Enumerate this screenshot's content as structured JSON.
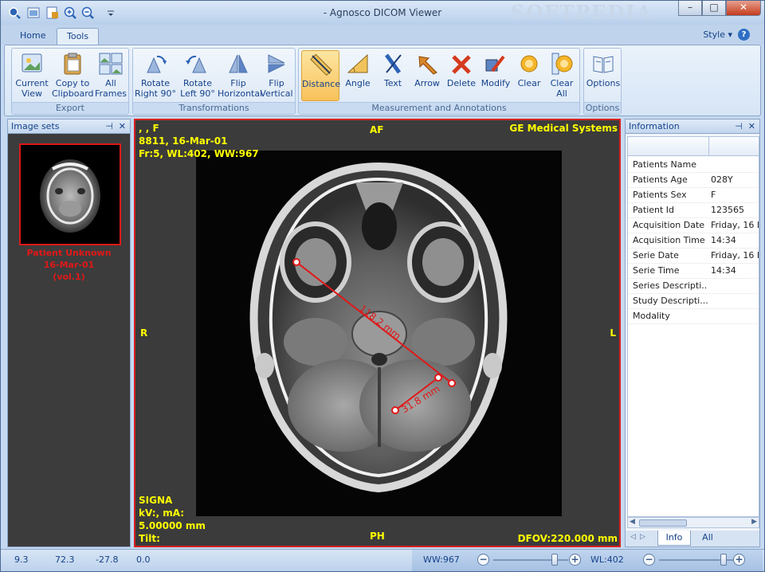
{
  "app": {
    "title": "- Agnosco DICOM Viewer",
    "watermark": "SOFTPEDIA"
  },
  "colors": {
    "annotation": "#e01818",
    "overlay_text": "#ffff00",
    "active_button": "#f9c15a"
  },
  "quick_access": [
    "open-icon",
    "save-icon",
    "export-icon",
    "zoom-in-icon",
    "zoom-out-icon",
    "customize-icon"
  ],
  "window_controls": {
    "minimize": "–",
    "maximize": "□",
    "close": "✕"
  },
  "tabs": [
    {
      "label": "Home"
    },
    {
      "label": "Tools",
      "active": true
    }
  ],
  "style_menu": {
    "label": "Style",
    "help": "?"
  },
  "ribbon": {
    "export": {
      "label": "Export",
      "buttons": [
        {
          "line1": "Current",
          "line2": "View"
        },
        {
          "line1": "Copy to",
          "line2": "Clipboard"
        },
        {
          "line1": "All",
          "line2": "Frames"
        }
      ]
    },
    "transformations": {
      "label": "Transformations",
      "buttons": [
        {
          "line1": "Rotate",
          "line2": "Right 90°"
        },
        {
          "line1": "Rotate",
          "line2": "Left 90°"
        },
        {
          "line1": "Flip",
          "line2": "Horizontal"
        },
        {
          "line1": "Flip",
          "line2": "Vertical"
        }
      ]
    },
    "measurement": {
      "label": "Measurement and Annotations",
      "buttons": [
        {
          "line1": "Distance",
          "line2": "",
          "active": true
        },
        {
          "line1": "Angle",
          "line2": ""
        },
        {
          "line1": "Text",
          "line2": ""
        },
        {
          "line1": "Arrow",
          "line2": ""
        },
        {
          "line1": "Delete",
          "line2": ""
        },
        {
          "line1": "Modify",
          "line2": ""
        },
        {
          "line1": "Clear",
          "line2": ""
        },
        {
          "line1": "Clear",
          "line2": "All"
        }
      ]
    },
    "options": {
      "label": "Options",
      "buttons": [
        {
          "line1": "Options",
          "line2": ""
        }
      ]
    }
  },
  "image_sets": {
    "title": "Image sets",
    "thumbnail": {
      "line1": "Patient Unknown",
      "line2": "16-Mar-01",
      "line3": "(vol.1)"
    }
  },
  "viewer": {
    "top_left": {
      "line1": ", , F",
      "line2": "8811, 16-Mar-01",
      "line3": "Fr:5, WL:402, WW:967"
    },
    "top_center": "AF",
    "top_right": "GE Medical Systems",
    "left": "R",
    "right": "L",
    "bottom_left": {
      "line1": "SIGNA",
      "line2": "kV:, mA:",
      "line3": "5.00000 mm",
      "line4": "Tilt:"
    },
    "bottom_center": "PH",
    "bottom_right": "DFOV:220.000 mm",
    "measurements": [
      {
        "label": "118.2 mm"
      },
      {
        "label": "31.8 mm"
      }
    ]
  },
  "info": {
    "title": "Information",
    "rows": [
      {
        "key": "Patients Name",
        "value": ""
      },
      {
        "key": "Patients Age",
        "value": "028Y"
      },
      {
        "key": "Patients Sex",
        "value": "F"
      },
      {
        "key": "Patient Id",
        "value": "123565"
      },
      {
        "key": "Acquisition Date",
        "value": "Friday, 16 M"
      },
      {
        "key": "Acquisition Time",
        "value": "14:34"
      },
      {
        "key": "Serie Date",
        "value": "Friday, 16 M"
      },
      {
        "key": "Serie Time",
        "value": "14:34"
      },
      {
        "key": "Series Descripti...",
        "value": ""
      },
      {
        "key": "Study Descripti...",
        "value": ""
      },
      {
        "key": "Modality",
        "value": ""
      }
    ],
    "tabs": [
      {
        "label": "Info",
        "active": true
      },
      {
        "label": "All"
      }
    ]
  },
  "status": {
    "values": [
      "9.3",
      "72.3",
      "-27.8",
      "0.0"
    ],
    "ww_label": "WW:967",
    "wl_label": "WL:402",
    "ww_slider": 0.82,
    "wl_slider": 0.86
  }
}
